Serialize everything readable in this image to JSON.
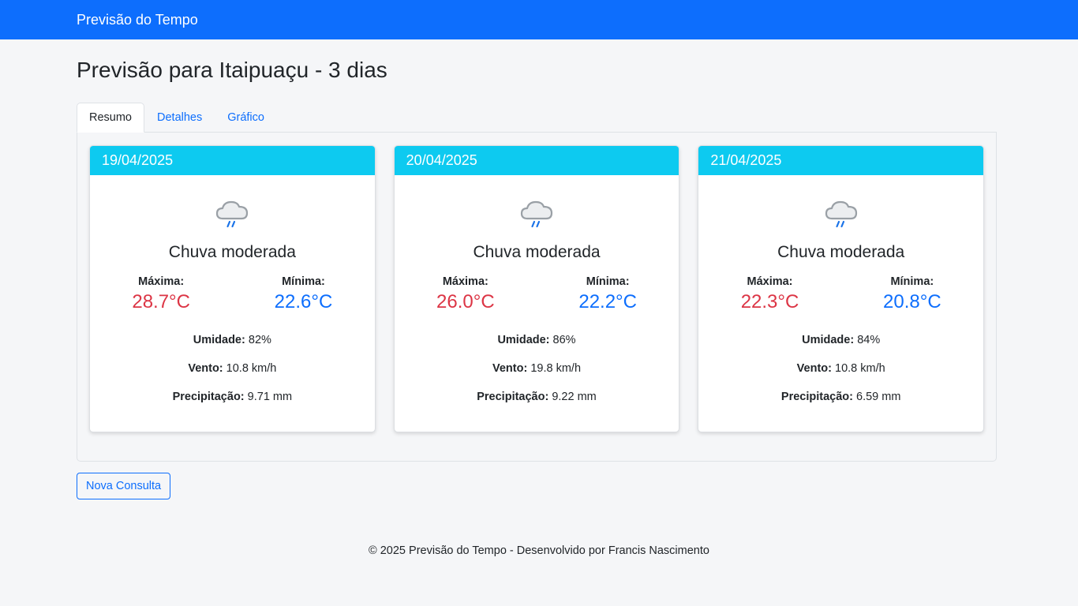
{
  "navbar": {
    "brand": "Previsão do Tempo"
  },
  "page": {
    "title": "Previsão para Itaipuaçu - 3 dias"
  },
  "tabs": [
    {
      "label": "Resumo",
      "active": true
    },
    {
      "label": "Detalhes",
      "active": false
    },
    {
      "label": "Gráfico",
      "active": false
    }
  ],
  "labels": {
    "max": "Máxima:",
    "min": "Mínima:",
    "humidity": "Umidade:",
    "wind": "Vento:",
    "precip": "Precipitação:"
  },
  "days": [
    {
      "date": "19/04/2025",
      "icon": "rain-cloud-icon",
      "condition": "Chuva moderada",
      "max": "28.7°C",
      "min": "22.6°C",
      "humidity": "82%",
      "wind": "10.8 km/h",
      "precip": "9.71 mm"
    },
    {
      "date": "20/04/2025",
      "icon": "rain-cloud-icon",
      "condition": "Chuva moderada",
      "max": "26.0°C",
      "min": "22.2°C",
      "humidity": "86%",
      "wind": "19.8 km/h",
      "precip": "9.22 mm"
    },
    {
      "date": "21/04/2025",
      "icon": "rain-cloud-icon",
      "condition": "Chuva moderada",
      "max": "22.3°C",
      "min": "20.8°C",
      "humidity": "84%",
      "wind": "10.8 km/h",
      "precip": "6.59 mm"
    }
  ],
  "actions": {
    "new_query": "Nova Consulta"
  },
  "footer": {
    "text": "© 2025 Previsão do Tempo - Desenvolvido por Francis Nascimento"
  },
  "colors": {
    "primary": "#0d6efd",
    "card_header": "#0dcaf0",
    "max_temp": "#dc3545",
    "min_temp": "#0d6efd"
  }
}
